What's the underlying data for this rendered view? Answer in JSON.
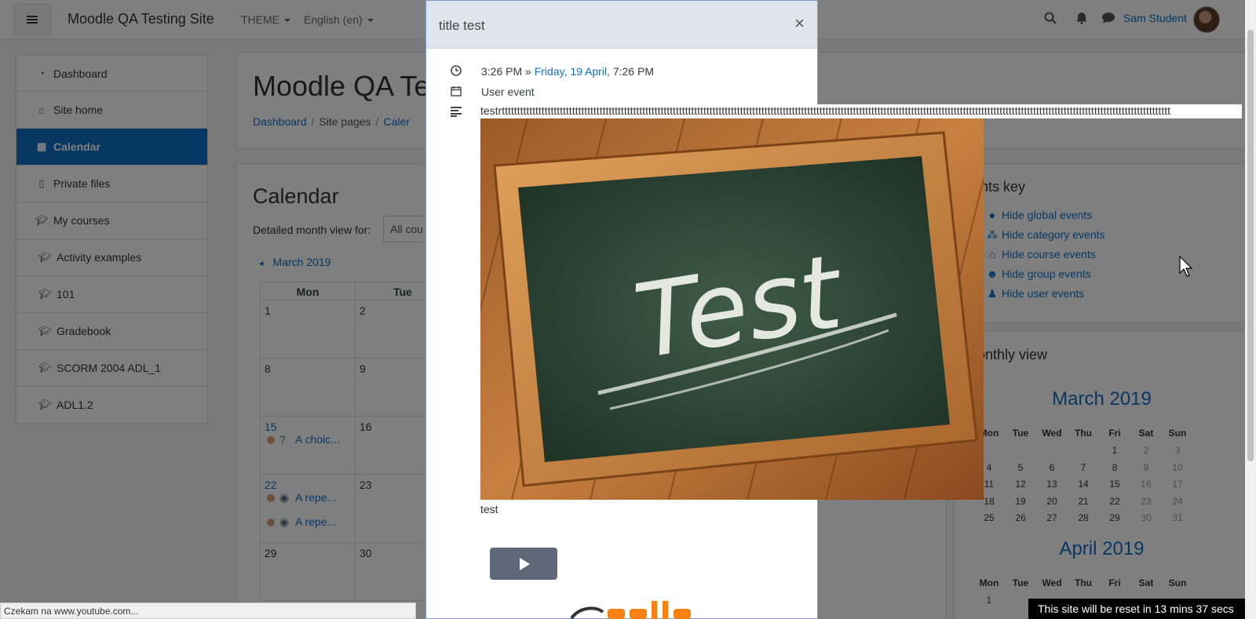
{
  "navbar": {
    "site_name": "Moodle QA Testing Site",
    "theme_menu": "THEME",
    "language_menu": "English (en)",
    "user_name": "Sam Student"
  },
  "sidenav": {
    "items": [
      {
        "label": "Dashboard",
        "icon": "dashboard-icon"
      },
      {
        "label": "Site home",
        "icon": "home-icon"
      },
      {
        "label": "Calendar",
        "icon": "calendar-icon"
      },
      {
        "label": "Private files",
        "icon": "file-icon"
      },
      {
        "label": "My courses",
        "icon": "graduation-cap-icon"
      },
      {
        "label": "Activity examples",
        "icon": "graduation-cap-icon"
      },
      {
        "label": "101",
        "icon": "graduation-cap-icon"
      },
      {
        "label": "Gradebook",
        "icon": "graduation-cap-icon"
      },
      {
        "label": "SCORM 2004 ADL_1",
        "icon": "graduation-cap-icon"
      },
      {
        "label": "ADL1.2",
        "icon": "graduation-cap-icon"
      }
    ],
    "active": "Calendar"
  },
  "page_header": {
    "title": "Moodle QA Te",
    "breadcrumb": [
      "Dashboard",
      "Site pages",
      "Caler"
    ]
  },
  "calendar": {
    "heading": "Calendar",
    "filter_label": "Detailed month view for:",
    "filter_value": "All cou",
    "prev_month": "March 2019",
    "weekday_headers": [
      "Mon",
      "Tue"
    ],
    "days": [
      "1",
      "2",
      "8",
      "9",
      "15",
      "16",
      "22",
      "23",
      "29",
      "30"
    ],
    "events": [
      {
        "label": "A choic...",
        "icon": "question-icon"
      },
      {
        "label": "A repe...",
        "icon": "chat-icon"
      },
      {
        "label": "A repe...",
        "icon": "chat-icon"
      }
    ]
  },
  "events_key": {
    "title": "vents key",
    "items": [
      {
        "label": "Hide global events",
        "icon": "globe-icon",
        "color": "#d8ecd8"
      },
      {
        "label": "Hide category events",
        "icon": "cubes-icon",
        "color": "#e2d8ef"
      },
      {
        "label": "Hide course events",
        "icon": "university-icon",
        "color": "#f5e3cf"
      },
      {
        "label": "Hide group events",
        "icon": "users-icon",
        "color": "#f5e8c4"
      },
      {
        "label": "Hide user events",
        "icon": "user-icon",
        "color": "#dbe6f2"
      }
    ]
  },
  "monthly_view": {
    "title": "Monthly view",
    "march": {
      "title": "March 2019",
      "headers": [
        "Mon",
        "Tue",
        "Wed",
        "Thu",
        "Fri",
        "Sat",
        "Sun"
      ],
      "rows": [
        [
          "",
          "",
          "",
          "",
          "1",
          "2",
          "3"
        ],
        [
          "4",
          "5",
          "6",
          "7",
          "8",
          "9",
          "10"
        ],
        [
          "11",
          "12",
          "13",
          "14",
          "15",
          "16",
          "17"
        ],
        [
          "18",
          "19",
          "20",
          "21",
          "22",
          "23",
          "24"
        ],
        [
          "25",
          "26",
          "27",
          "28",
          "29",
          "30",
          "31"
        ]
      ]
    },
    "april": {
      "title": "April 2019",
      "headers": [
        "Mon",
        "Tue",
        "Wed",
        "Thu",
        "Fri",
        "Sat",
        "Sun"
      ],
      "rows": [
        [
          "1"
        ]
      ]
    }
  },
  "modal": {
    "title": "title test",
    "close": "×",
    "time_start": "3:26 PM",
    "time_sep": "»",
    "time_link": "Friday, 19 April,",
    "time_end": "7:26 PM",
    "event_type": "User event",
    "description": "testrttttttttttttttttttttttttttttttttttttttttttttttttttttttttttttttttttttttttttttttttttttttttttttttttttttttttttttttttttttttttttttttttttttttttttttttttttttttttttttttttttttttttttttttttttttttttttttttttttttttttttttttttttttttttttt",
    "image_text": "Test",
    "caption": "test"
  },
  "status_bar": "Czekam na www.youtube.com...",
  "reset_notice": "This site will be reset in 13 mins 37 secs"
}
